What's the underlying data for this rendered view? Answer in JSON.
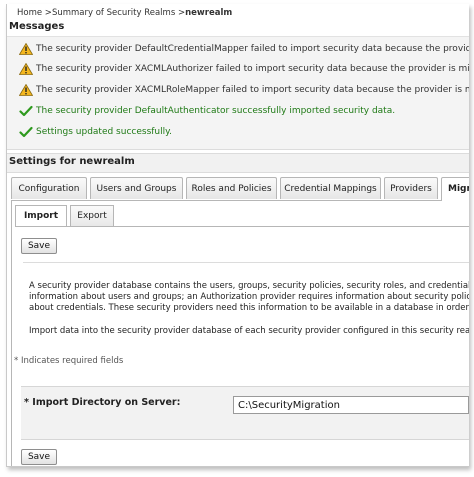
{
  "breadcrumb": {
    "home": "Home",
    "separator": " >",
    "realms": "Summary of Security Realms",
    "current": "newrealm"
  },
  "messages": {
    "title": "Messages",
    "items": [
      {
        "type": "warning",
        "icon": "warning-icon",
        "text": "The security provider DefaultCredentialMapper failed to import security data because the provider is missing"
      },
      {
        "type": "warning",
        "icon": "warning-icon",
        "text": "The security provider XACMLAuthorizer failed to import security data because the provider is missing"
      },
      {
        "type": "warning",
        "icon": "warning-icon",
        "text": "The security provider XACMLRoleMapper failed to import security data because the provider is missing"
      },
      {
        "type": "success",
        "icon": "checkmark-icon",
        "text": "The security provider DefaultAuthenticator successfully imported security data."
      },
      {
        "type": "success",
        "icon": "checkmark-icon",
        "text": "Settings updated successfully."
      }
    ]
  },
  "settings": {
    "title": "Settings for newrealm"
  },
  "tabs": [
    {
      "label": "Configuration"
    },
    {
      "label": "Users and Groups"
    },
    {
      "label": "Roles and Policies"
    },
    {
      "label": "Credential Mappings"
    },
    {
      "label": "Providers"
    },
    {
      "label": "Migration",
      "active": true
    }
  ],
  "subtabs": [
    {
      "label": "Import",
      "active": true
    },
    {
      "label": "Export"
    }
  ],
  "buttons": {
    "save_top": "Save",
    "save_bottom": "Save"
  },
  "description": {
    "lines": [
      "A security provider database contains the users, groups, security policies, security roles, and credentials",
      "information about users and groups; an Authorization provider requires information about security policies",
      "about credentials. These security providers need this information to be available in a database in order to"
    ],
    "import_line": "Import data into the security provider database of each security provider configured in this security realm"
  },
  "form": {
    "required_note": "* Indicates required fields",
    "import_dir_label": "Import Directory on Server:",
    "required_marker": "*",
    "import_dir_value": "C:\\SecurityMigration"
  },
  "colors": {
    "success_text": "#1f7a16",
    "warning_icon": "#e8a317"
  }
}
